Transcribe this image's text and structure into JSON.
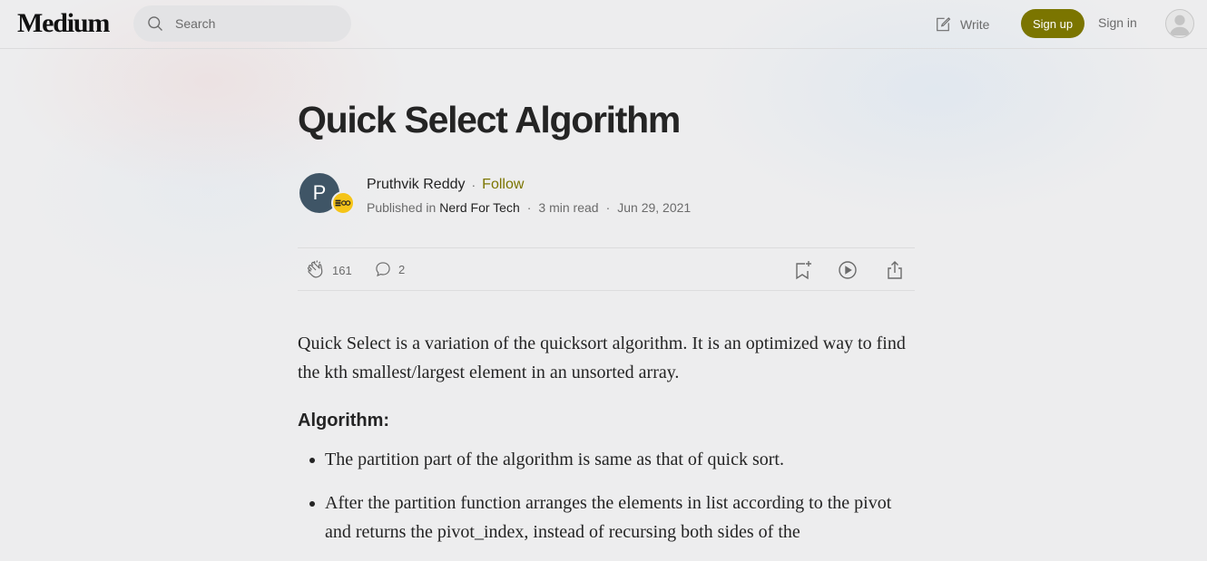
{
  "header": {
    "logo": "Medium",
    "search_placeholder": "Search",
    "write_label": "Write",
    "signup_label": "Sign up",
    "signin_label": "Sign in"
  },
  "article": {
    "title": "Quick Select Algorithm",
    "author": {
      "initial": "P",
      "name": "Pruthvik Reddy",
      "follow_label": "Follow"
    },
    "meta": {
      "published_in_label": "Published in",
      "publication": "Nerd For Tech",
      "read_time": "3 min read",
      "date": "Jun 29, 2021"
    },
    "actions": {
      "claps": "161",
      "comments": "2"
    },
    "intro": "Quick Select is a variation of the quicksort algorithm. It is an optimized way to find the kth smallest/largest element in an unsorted array.",
    "section_heading": "Algorithm:",
    "bullets": [
      "The partition part of the algorithm is same as that of quick sort.",
      "After the partition function arranges the elements in list according to the pivot and returns the pivot_index, instead of recursing both sides of the"
    ]
  },
  "colors": {
    "accent": "#7b7500",
    "background": "#ededee",
    "text": "#242424",
    "muted": "#6b6b6b",
    "author_avatar": "#3f5566",
    "publication_logo": "#f5c418"
  },
  "icons": {
    "search": "search-icon",
    "write": "write-icon",
    "clap": "clap-icon",
    "comment": "comment-icon",
    "bookmark": "bookmark-add-icon",
    "listen": "play-icon",
    "share": "share-icon",
    "user": "user-avatar-icon"
  }
}
